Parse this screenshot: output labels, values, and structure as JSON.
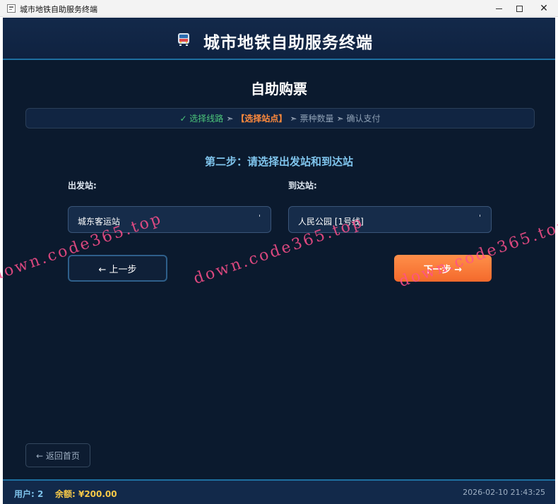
{
  "window": {
    "title": "城市地铁自助服务终端",
    "min_icon": "minimize-icon",
    "max_icon": "maximize-icon",
    "close_label": "✕"
  },
  "header": {
    "title": "城市地铁自助服务终端",
    "icon": "metro-train-icon"
  },
  "page": {
    "title": "自助购票"
  },
  "steps": [
    {
      "label": "✓ 选择线路",
      "state": "done"
    },
    {
      "label": "【选择站点】",
      "state": "current"
    },
    {
      "label": "票种数量",
      "state": "pending"
    },
    {
      "label": "确认支付",
      "state": "pending"
    }
  ],
  "step_separator": "➣",
  "step_heading": "第二步：请选择出发站和到达站",
  "from": {
    "label": "出发站:",
    "value": "城东客运站",
    "arrow": "ˈ"
  },
  "to": {
    "label": "到达站:",
    "value": "人民公园 [1号线]",
    "arrow": "ˈ"
  },
  "buttons": {
    "prev": "← 上一步",
    "next": "下一步 →",
    "home": "← 返回首页"
  },
  "footer": {
    "user": "用户: 2",
    "balance": "余额: ¥200.00",
    "datetime": "2026-02-10 21:43:25"
  },
  "watermark": "down.code365.top",
  "colors": {
    "background": "#0b1a2e",
    "accent": "#1e6fa0",
    "step_done": "#4cc77a",
    "step_current": "#ff8a3c",
    "next_button": "#f46a2c",
    "balance": "#f7c948",
    "watermark": "#ff508c"
  }
}
